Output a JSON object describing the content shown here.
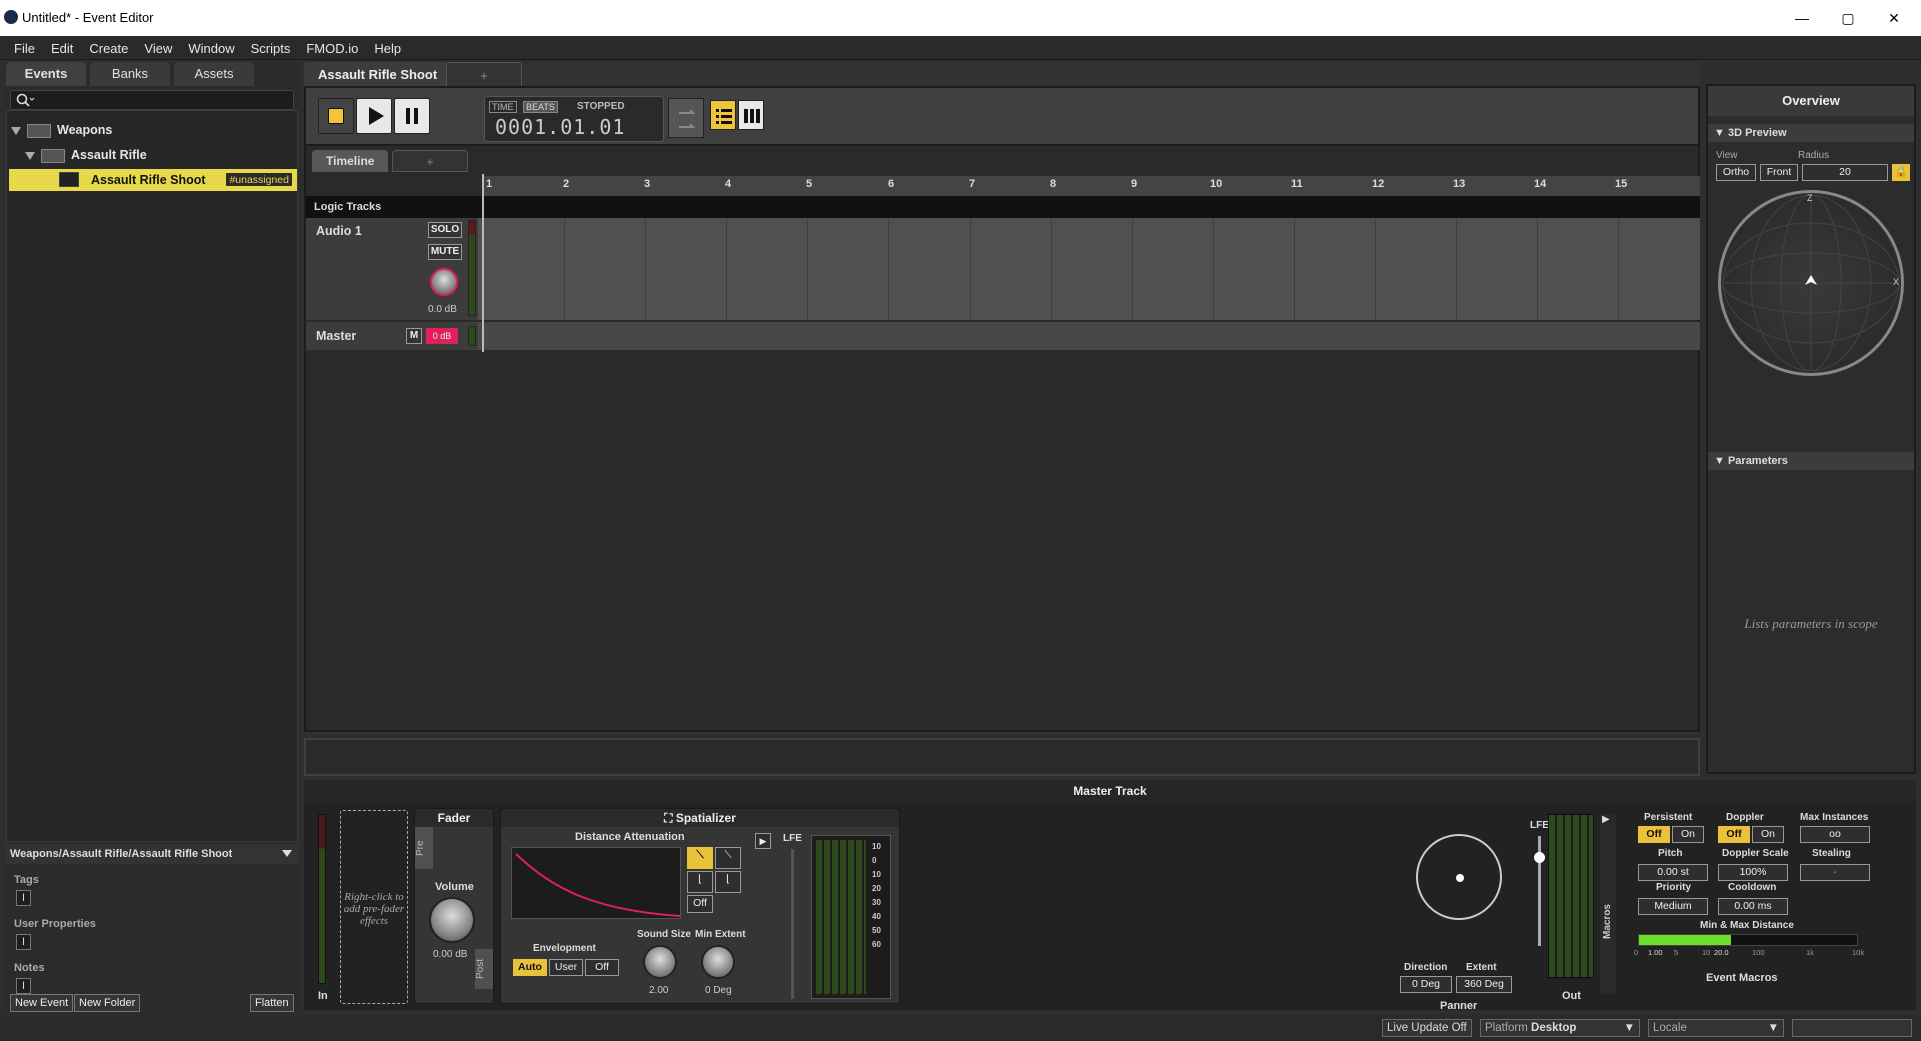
{
  "window": {
    "title": "Untitled* - Event Editor",
    "minimize": "—",
    "maximize": "▢",
    "close": "✕"
  },
  "menu": [
    "File",
    "Edit",
    "Create",
    "View",
    "Window",
    "Scripts",
    "FMOD.io",
    "Help"
  ],
  "left": {
    "tabs": [
      "Events",
      "Banks",
      "Assets"
    ],
    "tree": {
      "folder1": "Weapons",
      "folder2": "Assault Rifle",
      "event": "Assault Rifle Shoot",
      "badge": "#unassigned"
    },
    "path": "Weapons/Assault Rifle/Assault Rifle Shoot",
    "tags_label": "Tags",
    "user_props_label": "User Properties",
    "notes_label": "Notes",
    "buttons": {
      "new_event": "New Event",
      "new_folder": "New Folder",
      "flatten": "Flatten"
    }
  },
  "editor": {
    "tab": "Assault Rifle Shoot",
    "add_tab": "+",
    "time_label": "TIME",
    "beats_label": "BEATS",
    "state": "STOPPED",
    "position": "0001.01.01",
    "subtab": "Timeline",
    "add_subtab": "+",
    "ruler": [
      "1",
      "2",
      "3",
      "4",
      "5",
      "6",
      "7",
      "8",
      "9",
      "10",
      "11",
      "12",
      "13",
      "14",
      "15"
    ],
    "logic_tracks": "Logic Tracks",
    "audio_track": {
      "name": "Audio 1",
      "solo": "SOLO",
      "mute": "MUTE",
      "volume": "0.0 dB"
    },
    "master_track": {
      "name": "Master",
      "m": "M",
      "vol": "0 dB"
    }
  },
  "overview": {
    "title": "Overview",
    "preview_header": "3D Preview",
    "view_label": "View",
    "radius_label": "Radius",
    "ortho": "Ortho",
    "front": "Front",
    "radius": "20",
    "axis_z": "Z",
    "axis_x": "X",
    "params_header": "Parameters",
    "params_empty": "Lists parameters in scope"
  },
  "master": {
    "title": "Master Track",
    "in_label": "In",
    "out_label": "Out",
    "prefader_hint": "Right-click to add pre-fader effects",
    "fader": {
      "title": "Fader",
      "pre": "Pre",
      "post": "Post",
      "volume_label": "Volume",
      "volume": "0.00 dB"
    },
    "spatializer": {
      "title": "Spatializer",
      "distance_label": "Distance Attenuation",
      "off": "Off",
      "lfe": "LFE",
      "envelopment_label": "Envelopment",
      "env_options": [
        "Auto",
        "User",
        "Off"
      ],
      "sound_size_label": "Sound Size",
      "sound_size": "2.00",
      "min_extent_label": "Min Extent",
      "min_extent": "0 Deg",
      "meter_scale": [
        "10",
        "0",
        "10",
        "20",
        "30",
        "40",
        "50",
        "60"
      ]
    },
    "panner": {
      "title": "Panner",
      "lfe": "LFE",
      "direction_label": "Direction",
      "direction": "0 Deg",
      "extent_label": "Extent",
      "extent": "360 Deg"
    },
    "macros": {
      "title": "Event Macros",
      "side_label": "Macros",
      "persistent_label": "Persistent",
      "doppler_label": "Doppler",
      "max_instances_label": "Max Instances",
      "off": "Off",
      "on": "On",
      "max_instances": "oo",
      "pitch_label": "Pitch",
      "pitch": "0.00 st",
      "doppler_scale_label": "Doppler Scale",
      "doppler_scale": "100%",
      "stealing_label": "Stealing",
      "stealing": "-",
      "priority_label": "Priority",
      "priority": "Medium",
      "cooldown_label": "Cooldown",
      "cooldown": "0.00 ms",
      "distance_label": "Min & Max Distance",
      "dist_scale": [
        "0",
        "1.00",
        "5",
        "10",
        "20.0",
        "100",
        "1k",
        "10k"
      ]
    }
  },
  "status": {
    "live_update": "Live Update Off",
    "platform_label": "Platform",
    "platform": "Desktop",
    "locale_label": "Locale"
  },
  "colors": {
    "accent": "#e8c23a",
    "selection": "#e8d94a",
    "curve": "#e0205a",
    "meter_green": "#6ee02a"
  }
}
